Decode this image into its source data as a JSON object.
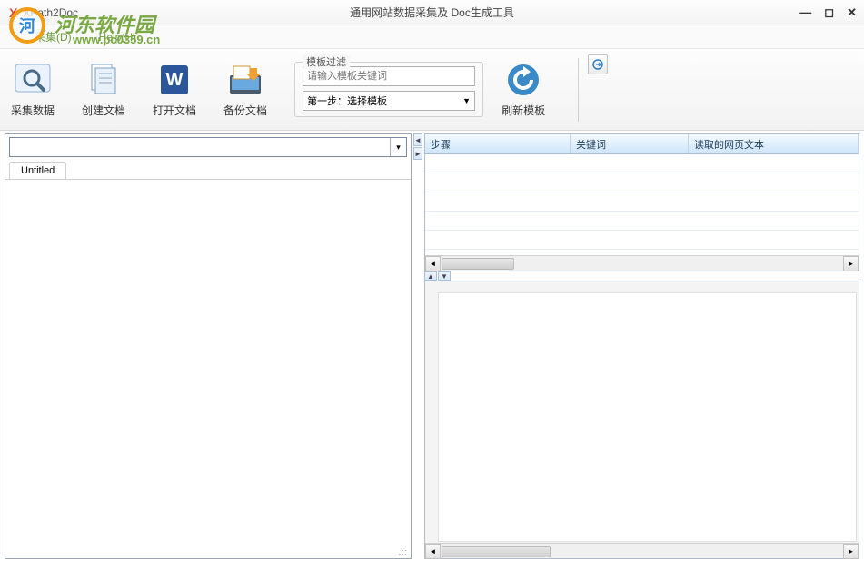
{
  "titlebar": {
    "x_icon": "X",
    "app_name": "XPath2Doc",
    "center_title": "通用网站数据采集及 Doc生成工具"
  },
  "watermark": {
    "text1": "河东软件园",
    "text2": "www.pc0359.cn"
  },
  "menubar": {
    "collect": "采集(D)",
    "help": "Help(H)"
  },
  "toolbar": {
    "collect_data": "采集数据",
    "create_doc": "创建文档",
    "open_doc": "打开文档",
    "backup_doc": "备份文档",
    "refresh_template": "刷新模板"
  },
  "filter": {
    "legend": "模板过滤",
    "placeholder": "请输入模板关键词",
    "select_text": "第一步：选择模板"
  },
  "left": {
    "tab1": "Untitled"
  },
  "grid": {
    "col1": "步骤",
    "col2": "关键词",
    "col3": "读取的网页文本"
  }
}
